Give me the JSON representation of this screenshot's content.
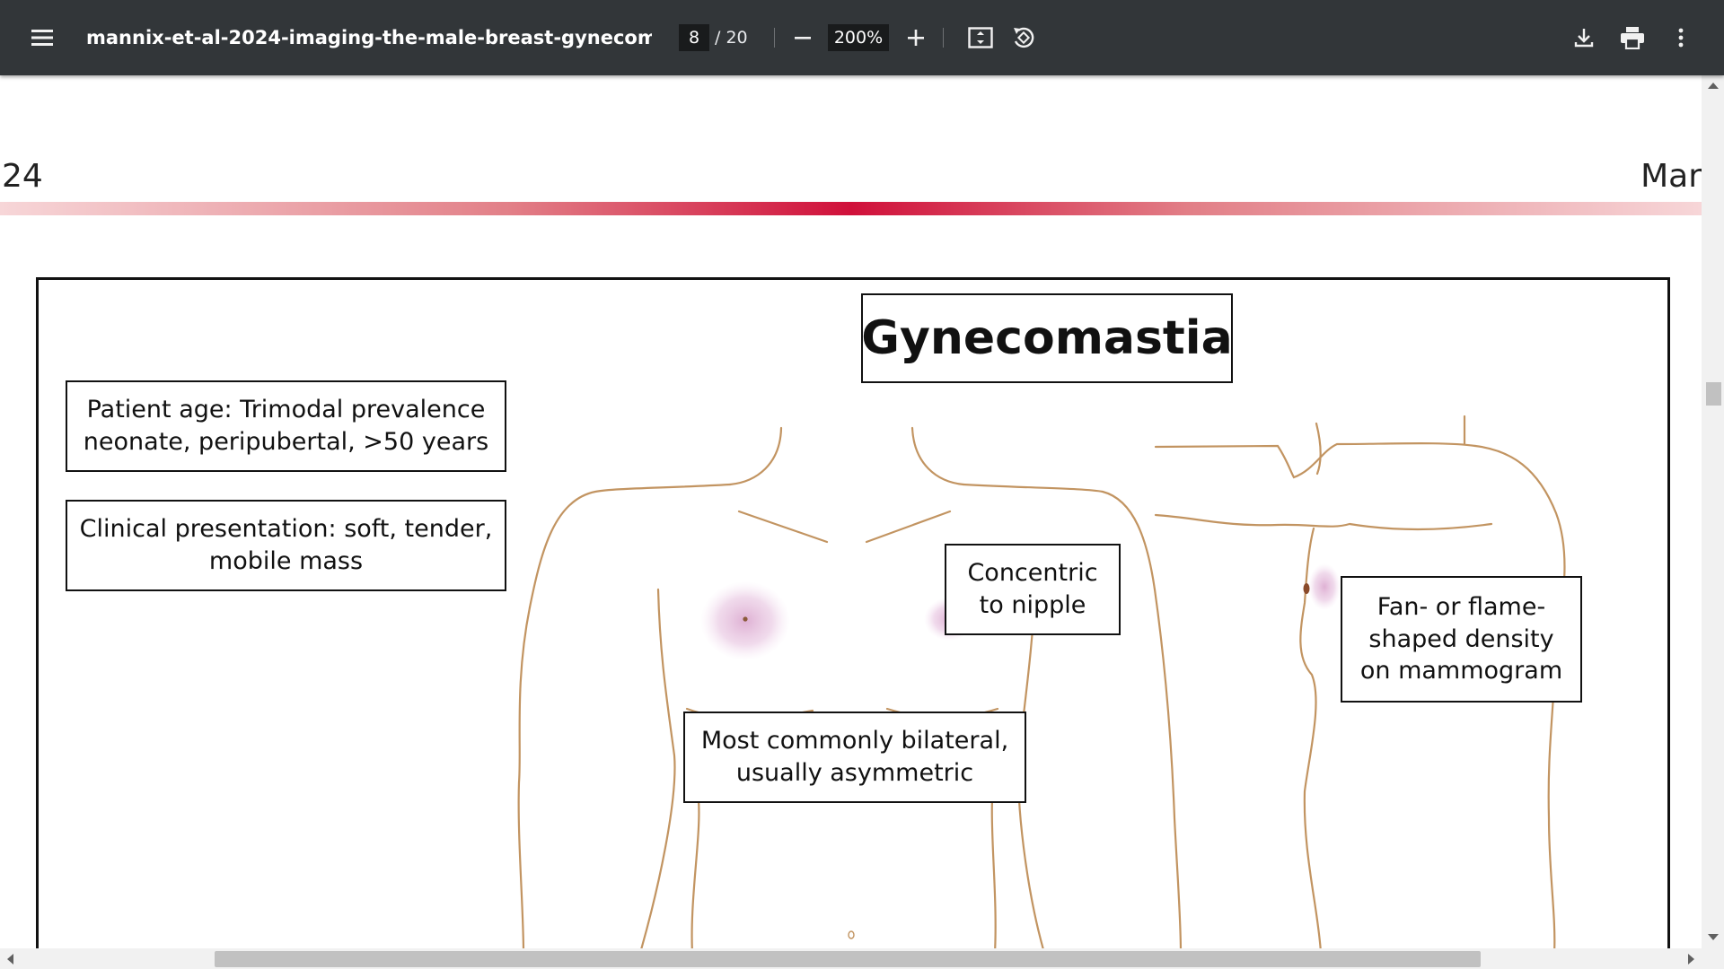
{
  "toolbar": {
    "title": "mannix-et-al-2024-imaging-the-male-breast-gynecomastia-mal...",
    "page_current": "8",
    "page_total": "/ 20",
    "zoom": "200%",
    "icons": [
      "menu-icon",
      "zoom-out-icon",
      "zoom-in-icon",
      "fit-page-icon",
      "rotate-icon",
      "download-icon",
      "print-icon",
      "more-vert-icon"
    ]
  },
  "document": {
    "header_left": "24",
    "header_right": "Mar",
    "rule_colors": [
      "#f7d6d8",
      "#e27f87",
      "#d0103a"
    ]
  },
  "figure": {
    "title": "Gynecomastia",
    "labels": {
      "patient_age": "Patient age: Trimodal prevalence\nneonate, peripubertal, >50 years",
      "clinical": "Clinical presentation: soft, tender,\nmobile mass",
      "concentric": "Concentric\nto nipple",
      "bilateral": "Most commonly bilateral,\nusually asymmetric",
      "fan_shaped": "Fan- or flame-\nshaped density\non mammogram"
    },
    "colors": {
      "outline": "#c29461",
      "density": "#d9a3cc"
    }
  }
}
